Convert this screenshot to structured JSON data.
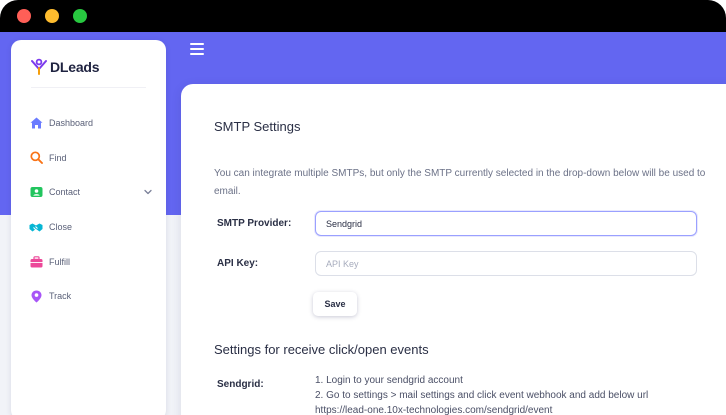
{
  "window": {
    "controls": [
      "close",
      "minimize",
      "maximize"
    ]
  },
  "brand": {
    "name": "DLeads",
    "logo_icon": "person-raised-arms-icon",
    "logo_color": "#7c3aed"
  },
  "theme": {
    "accent": "#6366f1"
  },
  "sidebar": {
    "items": [
      {
        "label": "Dashboard",
        "icon": "home-icon",
        "color": "#6b7cff"
      },
      {
        "label": "Find",
        "icon": "search-icon",
        "color": "#f97316"
      },
      {
        "label": "Contact",
        "icon": "contact-icon",
        "color": "#22c55e",
        "has_submenu": true
      },
      {
        "label": "Close",
        "icon": "handshake-icon",
        "color": "#06b6d4"
      },
      {
        "label": "Fulfill",
        "icon": "briefcase-icon",
        "color": "#ec4899"
      },
      {
        "label": "Track",
        "icon": "location-pin-icon",
        "color": "#a855f7"
      }
    ]
  },
  "page": {
    "title": "SMTP Settings",
    "description_line1": "You can integrate multiple SMTPs, but only the SMTP currently selected in the drop-down below will be used to",
    "description_line2": "email.",
    "smtp_provider": {
      "label": "SMTP Provider:",
      "value": "Sendgrid"
    },
    "api_key": {
      "label": "API Key:",
      "placeholder": "API Key",
      "value": ""
    },
    "save_label": "Save",
    "events_title": "Settings for receive click/open events",
    "sendgrid": {
      "label": "Sendgrid:",
      "steps": [
        "1. Login to your sendgrid account",
        "2. Go to settings > mail settings and click event webhook and add below url",
        "https://lead-one.10x-technologies.com/sendgrid/event"
      ]
    }
  }
}
